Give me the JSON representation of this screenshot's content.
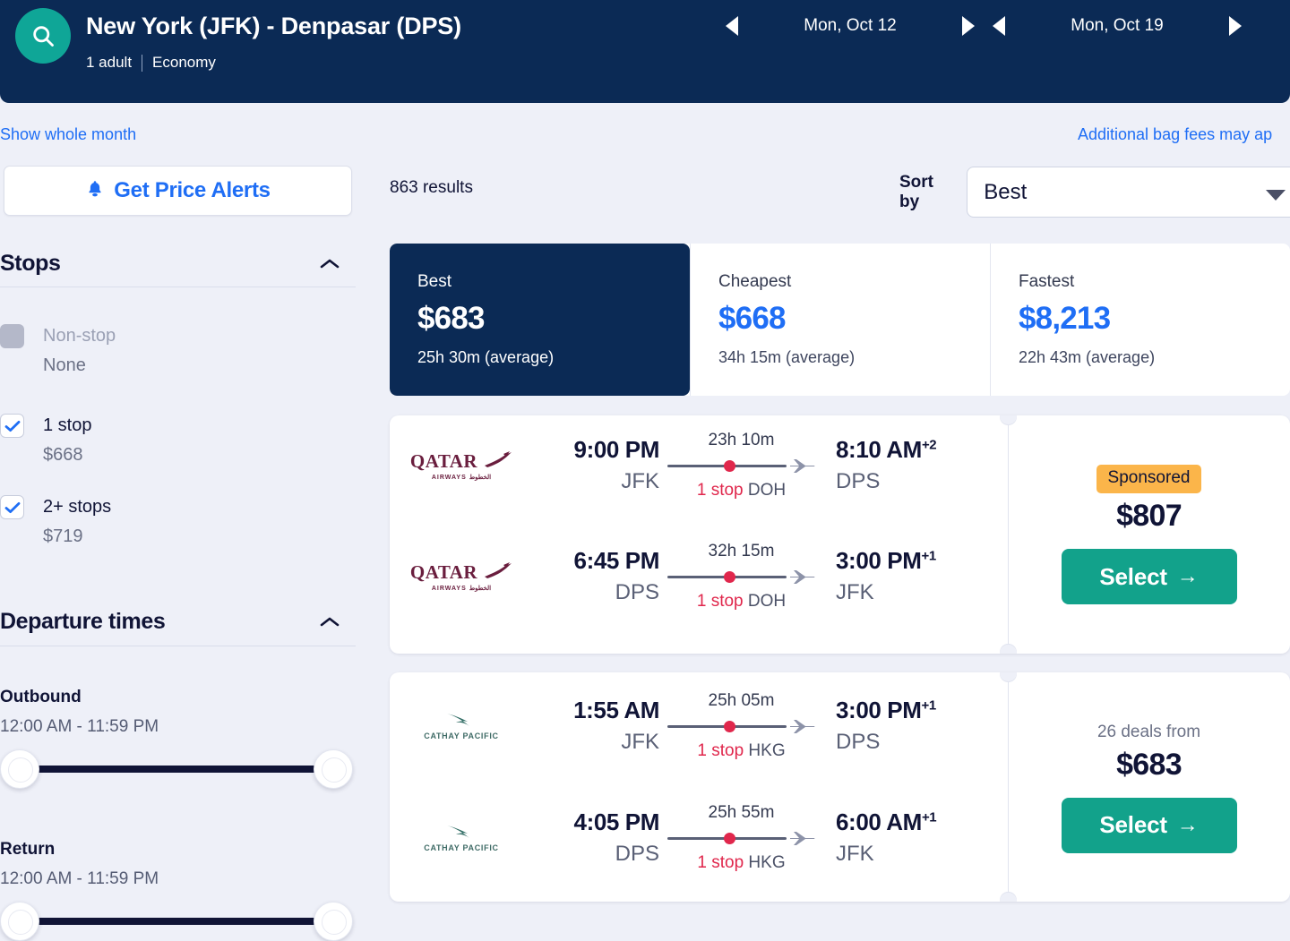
{
  "header": {
    "search_icon": "search-icon",
    "route_title": "New York (JFK) - Denpasar (DPS)",
    "passengers": "1 adult",
    "cabin": "Economy",
    "depart_date": "Mon, Oct 12",
    "return_date": "Mon, Oct 19",
    "bg_color": "#0b2a55",
    "badge_color": "#0fa697"
  },
  "links": {
    "show_whole_month": "Show whole month",
    "bag_fees": "Additional bag fees may ap",
    "link_color": "#1f6ef5"
  },
  "sidebar": {
    "price_alerts_label": "Get Price Alerts",
    "bell_icon": "bell-icon",
    "stops": {
      "title": "Stops",
      "options": [
        {
          "label": "Non-stop",
          "price": "None",
          "checked": false,
          "disabled": true
        },
        {
          "label": "1 stop",
          "price": "$668",
          "checked": true,
          "disabled": false
        },
        {
          "label": "2+ stops",
          "price": "$719",
          "checked": true,
          "disabled": false
        }
      ]
    },
    "departure_times": {
      "title": "Departure times",
      "outbound_label": "Outbound",
      "outbound_range": "12:00 AM - 11:59 PM",
      "return_label": "Return",
      "return_range": "12:00 AM - 11:59 PM"
    }
  },
  "results": {
    "count_label": "863 results",
    "sort_by_label": "Sort by",
    "sort_value": "Best",
    "sort_options": [
      "Best",
      "Cheapest",
      "Fastest"
    ]
  },
  "tabs": [
    {
      "name": "Best",
      "price": "$683",
      "duration": "25h 30m (average)",
      "active": true
    },
    {
      "name": "Cheapest",
      "price": "$668",
      "duration": "34h 15m (average)",
      "active": false
    },
    {
      "name": "Fastest",
      "price": "$8,213",
      "duration": "22h 43m (average)",
      "active": false
    }
  ],
  "flights": [
    {
      "airline": "QATAR AIRWAYS",
      "airline_sub": "AIRWAYS",
      "legs": [
        {
          "depart_time": "9:00 PM",
          "depart_code": "JFK",
          "duration": "23h 10m",
          "arrive_time": "8:10 AM",
          "arrive_offset": "+2",
          "arrive_code": "DPS",
          "stops": "1 stop",
          "stop_code": "DOH"
        },
        {
          "depart_time": "6:45 PM",
          "depart_code": "DPS",
          "duration": "32h 15m",
          "arrive_time": "3:00 PM",
          "arrive_offset": "+1",
          "arrive_code": "JFK",
          "stops": "1 stop",
          "stop_code": "DOH"
        }
      ],
      "badge": "Sponsored",
      "deals_text": "",
      "price": "$807",
      "select_label": "Select"
    },
    {
      "airline": "CATHAY PACIFIC",
      "airline_sub": "",
      "legs": [
        {
          "depart_time": "1:55 AM",
          "depart_code": "JFK",
          "duration": "25h 05m",
          "arrive_time": "3:00 PM",
          "arrive_offset": "+1",
          "arrive_code": "DPS",
          "stops": "1 stop",
          "stop_code": "HKG"
        },
        {
          "depart_time": "4:05 PM",
          "depart_code": "DPS",
          "duration": "25h 55m",
          "arrive_time": "6:00 AM",
          "arrive_offset": "+1",
          "arrive_code": "JFK",
          "stops": "1 stop",
          "stop_code": "HKG"
        }
      ],
      "badge": "",
      "deals_text": "26 deals from",
      "price": "$683",
      "select_label": "Select"
    }
  ],
  "colors": {
    "accent_blue": "#1f6ef5",
    "navy": "#0b2a55",
    "teal": "#12a28b",
    "orange": "#fbb54a",
    "red": "#e0274c"
  }
}
